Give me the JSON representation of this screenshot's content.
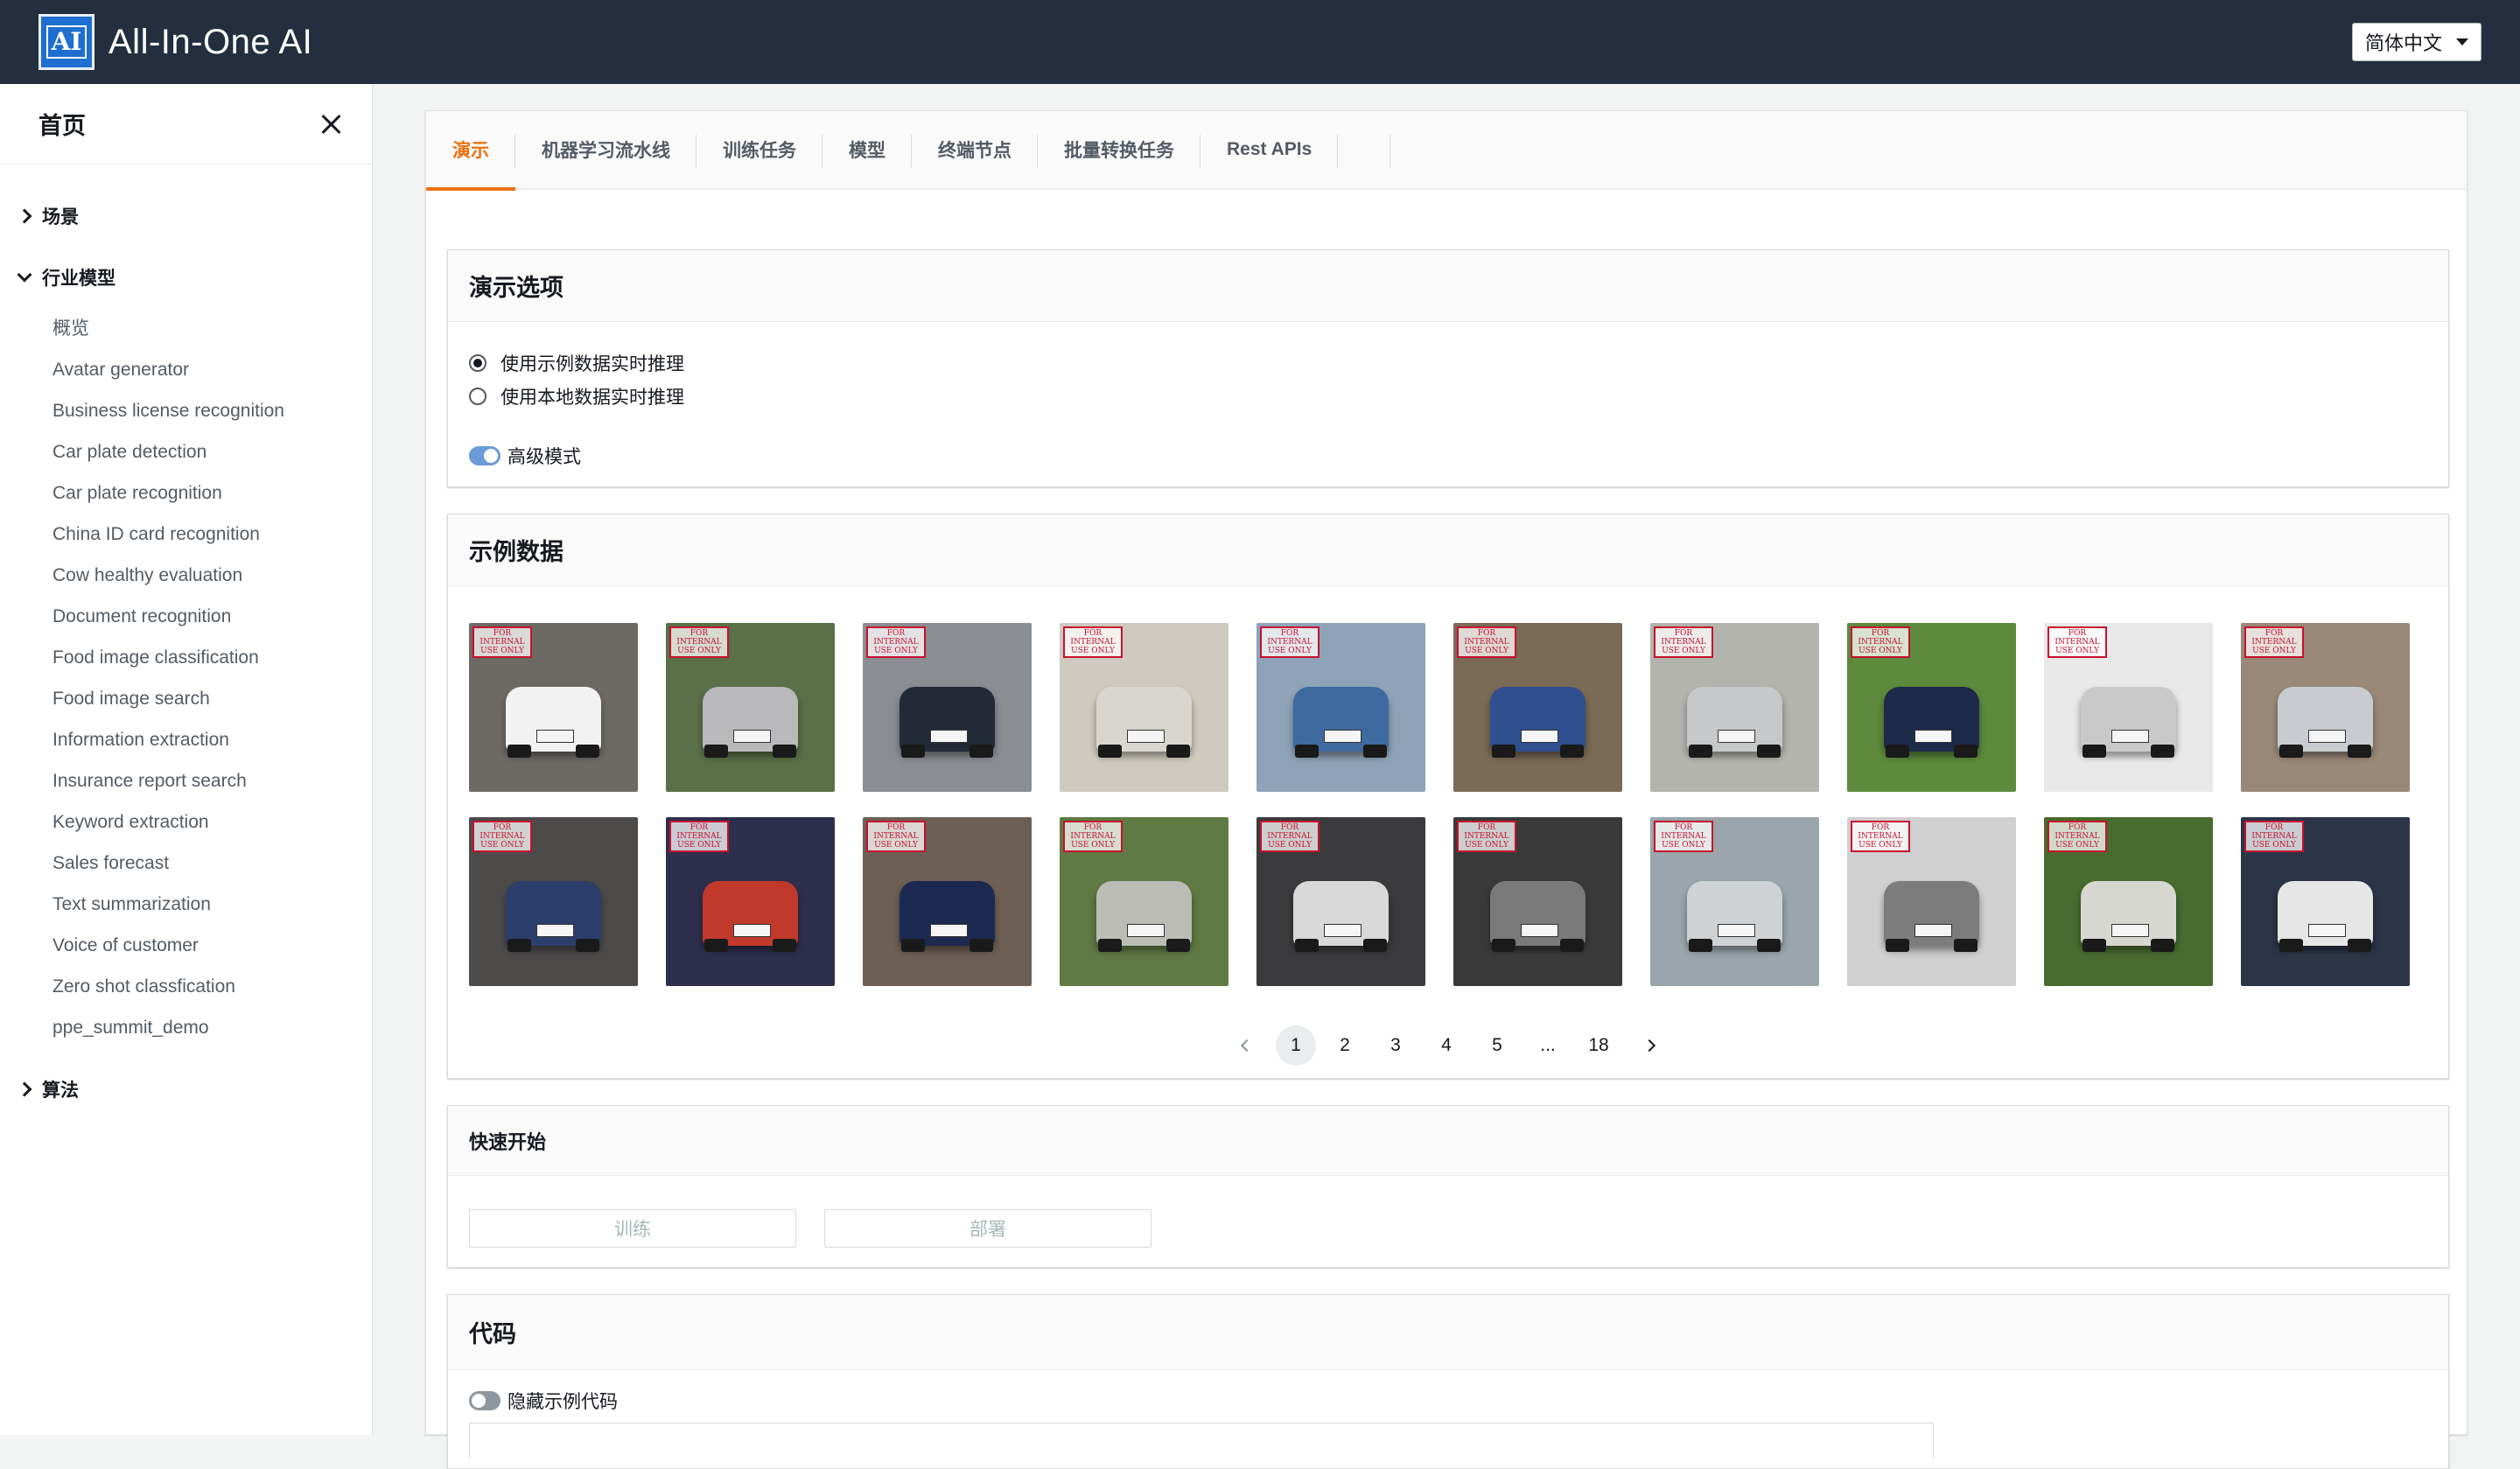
{
  "header": {
    "logo_text": "AI",
    "title": "All-In-One AI",
    "language": "简体中文"
  },
  "sidebar": {
    "title": "首页",
    "sections": {
      "scenes": "场景",
      "industry": "行业模型",
      "algorithms": "算法"
    },
    "items": [
      {
        "label": "概览"
      },
      {
        "label": "Avatar generator"
      },
      {
        "label": "Business license recognition"
      },
      {
        "label": "Car plate detection"
      },
      {
        "label": "Car plate recognition"
      },
      {
        "label": "China ID card recognition"
      },
      {
        "label": "Cow healthy evaluation"
      },
      {
        "label": "Document recognition"
      },
      {
        "label": "Food image classification"
      },
      {
        "label": "Food image search"
      },
      {
        "label": "Information extraction"
      },
      {
        "label": "Insurance report search"
      },
      {
        "label": "Keyword extraction"
      },
      {
        "label": "Sales forecast"
      },
      {
        "label": "Text summarization"
      },
      {
        "label": "Voice of customer"
      },
      {
        "label": "Zero shot classfication"
      },
      {
        "label": "ppe_summit_demo"
      }
    ]
  },
  "tabs": [
    {
      "label": "演示",
      "active": true
    },
    {
      "label": "机器学习流水线"
    },
    {
      "label": "训练任务"
    },
    {
      "label": "模型"
    },
    {
      "label": "终端节点"
    },
    {
      "label": "批量转换任务"
    },
    {
      "label": "Rest APIs"
    }
  ],
  "demo_options": {
    "title": "演示选项",
    "radio_sample": "使用示例数据实时推理",
    "radio_local": "使用本地数据实时推理",
    "advanced_mode": "高级模式",
    "selected": "sample",
    "advanced_on": true
  },
  "sample_data": {
    "title": "示例数据",
    "stamp_text": "FOR INTERNAL USE ONLY",
    "thumbnails": [
      {
        "bg": "#6d6a66",
        "car": "#f2f2f2"
      },
      {
        "bg": "#5a7048",
        "car": "#b9b9bb"
      },
      {
        "bg": "#8a8d92",
        "car": "#232a36"
      },
      {
        "bg": "#cfcac0",
        "car": "#d9d6cf"
      },
      {
        "bg": "#8fa3b8",
        "car": "#3f6aa0"
      },
      {
        "bg": "#7b6a55",
        "car": "#2f4f8f"
      },
      {
        "bg": "#b3b4ad",
        "car": "#c6c8c9"
      },
      {
        "bg": "#5d8a3c",
        "car": "#1e2a4a"
      },
      {
        "bg": "#e8e8e8",
        "car": "#c9c9c9"
      },
      {
        "bg": "#9a8878",
        "car": "#c8ccd0"
      },
      {
        "bg": "#4d4a4a",
        "car": "#2c3e6b"
      },
      {
        "bg": "#2e2f4d",
        "car": "#c0392b"
      },
      {
        "bg": "#6e5f55",
        "car": "#1c2950"
      },
      {
        "bg": "#5f7a44",
        "car": "#bcbcb6"
      },
      {
        "bg": "#3b3b3d",
        "car": "#d8d8d8"
      },
      {
        "bg": "#3a3a3a",
        "car": "#7a7a7a"
      },
      {
        "bg": "#9aa6ab",
        "car": "#cfd2d4"
      },
      {
        "bg": "#d0d0d0",
        "car": "#7c7c7c"
      },
      {
        "bg": "#486b2f",
        "car": "#d7d7d2"
      },
      {
        "bg": "#2c3447",
        "car": "#e6e6e6"
      }
    ],
    "pagination": {
      "pages": [
        "1",
        "2",
        "3",
        "4",
        "5",
        "...",
        "18"
      ],
      "current": "1"
    }
  },
  "quick_start": {
    "title": "快速开始",
    "train": "训练",
    "deploy": "部署"
  },
  "code": {
    "title": "代码",
    "hide_sample_code": "隐藏示例代码",
    "hide_on": false
  },
  "colors": {
    "accent": "#ec7211",
    "header_bg": "#232f3e",
    "stamp": "#c8102e"
  }
}
